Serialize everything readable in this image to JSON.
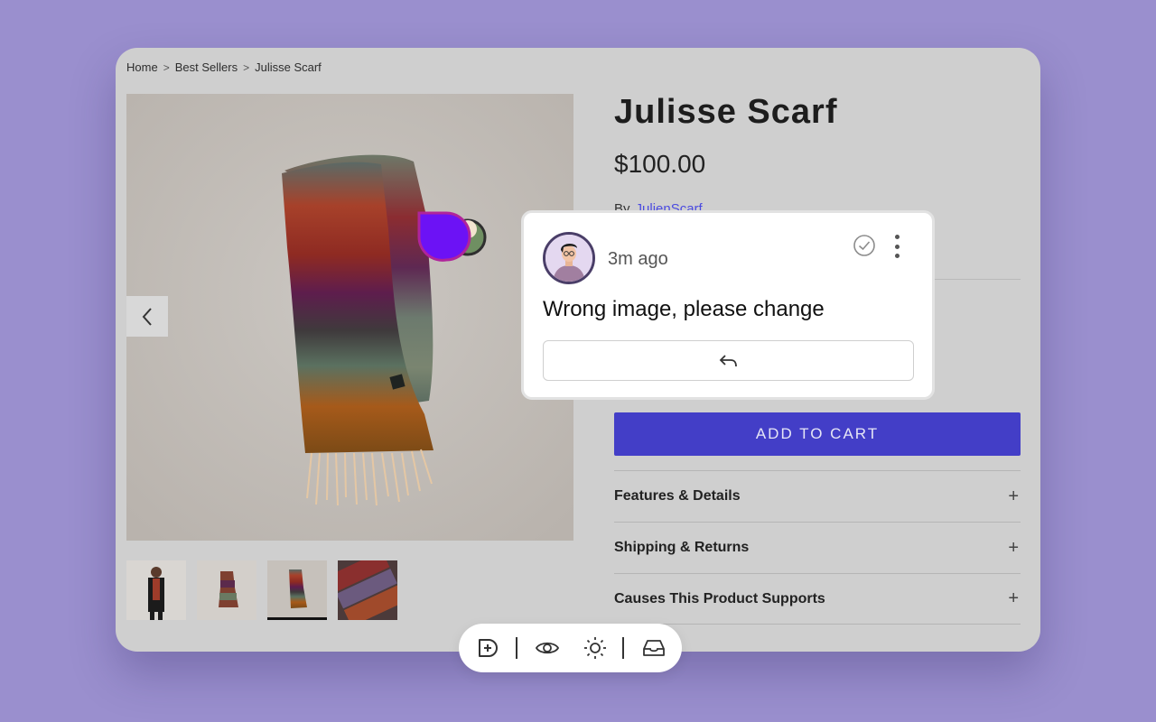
{
  "breadcrumb": {
    "items": [
      "Home",
      "Best Sellers",
      "Julisse Scarf"
    ],
    "separator": ">"
  },
  "product": {
    "title": "Julisse Scarf",
    "price": "$100.00",
    "by_label": "By",
    "brand": "JulienScarf",
    "add_to_cart": "ADD TO CART",
    "accordion": [
      {
        "label": "Features & Details",
        "icon": "+"
      },
      {
        "label": "Shipping & Returns",
        "icon": "+"
      },
      {
        "label": "Causes This Product Supports",
        "icon": "+"
      }
    ]
  },
  "gallery": {
    "prev_icon": "chevron-left-icon",
    "thumbnails": [
      "person-wearing-scarf",
      "scarf-folded",
      "scarf-flat",
      "scarf-closeup"
    ],
    "active_thumbnail": 3
  },
  "comment": {
    "time": "3m ago",
    "text": "Wrong image, please change",
    "resolve_icon": "check-circle-icon",
    "more_icon": "more-vertical-icon",
    "reply_icon": "reply-icon"
  },
  "toolbar": {
    "items": [
      "add-comment-icon",
      "eye-icon",
      "sun-icon",
      "inbox-icon"
    ]
  },
  "colors": {
    "background": "#9a8fce",
    "accent": "#433ec7",
    "pin": "#6c12f5",
    "link": "#4b4be0"
  }
}
